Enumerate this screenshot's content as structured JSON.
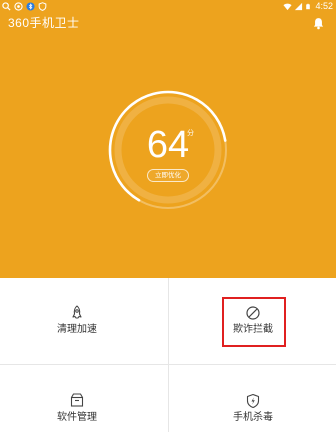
{
  "status_bar": {
    "time": "4:52",
    "left_icons": [
      "search-icon",
      "circle-icon",
      "bluetooth-icon",
      "shield-icon"
    ],
    "right_icons": [
      "wifi-icon",
      "signal-icon",
      "battery-icon"
    ]
  },
  "header": {
    "app_title": "360手机卫士",
    "bell_icon": "bell-icon"
  },
  "score": {
    "value": "64",
    "unit": "分",
    "level": 64,
    "max": 100,
    "action_label": "立即优化"
  },
  "tiles": [
    {
      "label": "清理加速",
      "icon": "rocket-icon"
    },
    {
      "label": "欺诈拦截",
      "icon": "block-icon"
    },
    {
      "label": "软件管理",
      "icon": "box-icon"
    },
    {
      "label": "手机杀毒",
      "icon": "shield-bolt-icon"
    }
  ],
  "colors": {
    "accent": "#EDA31E",
    "highlight": "#E02020",
    "label": "#333333",
    "icon": "#444444"
  }
}
